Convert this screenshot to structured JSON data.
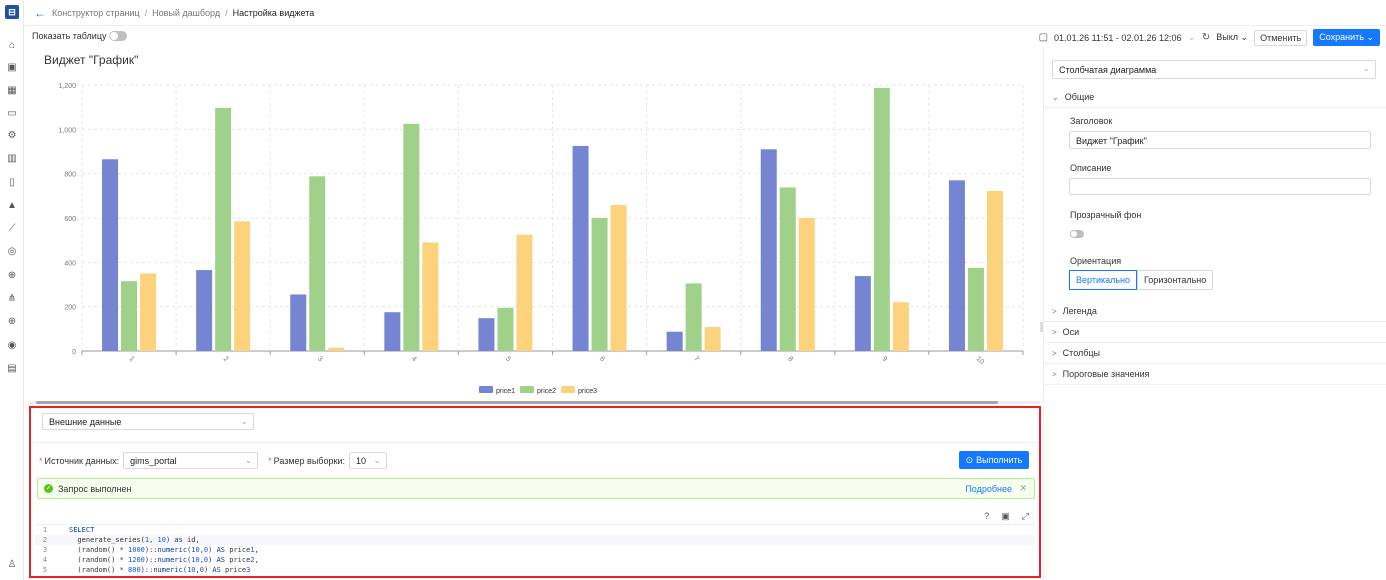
{
  "breadcrumb": [
    "Конструктор страниц",
    "Новый дашборд",
    "Настройка виджета"
  ],
  "toolbar": {
    "show_table_label": "Показать таблицу",
    "date_range": "01.01.26 11:51 - 02.01.26 12:06",
    "auto_refresh": "Выкл",
    "cancel_label": "Отменить",
    "save_label": "Сохранить"
  },
  "widget_title": "Виджет \"График\"",
  "chart_data": {
    "type": "bar",
    "categories": [
      "1",
      "2",
      "3",
      "4",
      "5",
      "6",
      "7",
      "8",
      "9",
      "10"
    ],
    "series": [
      {
        "name": "price1",
        "color": "#7585d2",
        "values": [
          865,
          365,
          255,
          175,
          148,
          925,
          87,
          910,
          338,
          770
        ]
      },
      {
        "name": "price2",
        "color": "#a0d18a",
        "values": [
          315,
          1097,
          788,
          1025,
          195,
          600,
          305,
          738,
          1187,
          375
        ]
      },
      {
        "name": "price3",
        "color": "#fcd27c",
        "values": [
          350,
          585,
          15,
          490,
          525,
          658,
          108,
          600,
          220,
          722
        ]
      }
    ],
    "yticks": [
      "0",
      "200",
      "400",
      "600",
      "800",
      "1,000",
      "1,200"
    ],
    "ylim": [
      0,
      1200
    ],
    "grid": true,
    "legend": "bottom"
  },
  "query": {
    "source_type": "Внешние данные",
    "datasource_label": "Источник данных:",
    "datasource_value": "gims_portal",
    "sample_size_label": "Размер выборки:",
    "sample_size_value": "10",
    "execute_label": "Выполнить",
    "status_text": "Запрос выполнен",
    "details_label": "Подробнее",
    "code_lines": [
      {
        "n": "1",
        "text": "SELECT"
      },
      {
        "n": "2",
        "text": "  generate_series(1, 10) as id,"
      },
      {
        "n": "3",
        "text": "  (random() * 1000)::numeric(10,0) AS price1,"
      },
      {
        "n": "4",
        "text": "  (random() * 1200)::numeric(10,0) AS price2,"
      },
      {
        "n": "5",
        "text": "  (random() * 800)::numeric(10,0) AS price3"
      }
    ]
  },
  "settings": {
    "chart_type": "Столбчатая диаграмма",
    "section_general": "Общие",
    "title_label": "Заголовок",
    "title_value": "Виджет \"График\"",
    "description_label": "Описание",
    "transparent_label": "Прозрачный фон",
    "orientation_label": "Ориентация",
    "orientation_vertical": "Вертикально",
    "orientation_horizontal": "Горизонтально",
    "section_legend": "Легенда",
    "section_axes": "Оси",
    "section_bars": "Столбцы",
    "section_thresholds": "Пороговые значения"
  }
}
